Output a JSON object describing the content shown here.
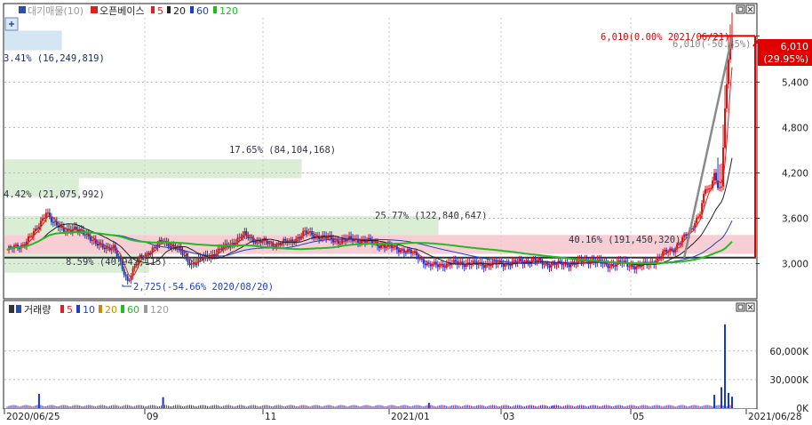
{
  "legend_top": {
    "items": [
      {
        "text": "대기매물(10)",
        "color": "#9a9a9a"
      },
      {
        "text": "오픈베이스",
        "color": "#222222"
      },
      {
        "text": "5",
        "color": "#dd2020"
      },
      {
        "text": "20",
        "color": "#222222"
      },
      {
        "text": "60",
        "color": "#1a3fd0"
      },
      {
        "text": "120",
        "color": "#22bb22"
      }
    ]
  },
  "legend_bottom": {
    "items": [
      {
        "text": "거래량",
        "color": "#222222"
      },
      {
        "text": "5",
        "color": "#dd2020"
      },
      {
        "text": "10",
        "color": "#1a3fd0"
      },
      {
        "text": "20",
        "color": "#d08a00"
      },
      {
        "text": "60",
        "color": "#22bb22"
      },
      {
        "text": "120",
        "color": "#9a9a9a"
      }
    ]
  },
  "chart_data": [
    {
      "type": "candlestick",
      "ylim": [
        2560,
        6250
      ],
      "price_ticks": [
        "6,010",
        "5,400",
        "4,800",
        "4,200",
        "3,600",
        "3,000"
      ],
      "price_tick_values": [
        6010,
        5400,
        4800,
        4200,
        3600,
        3000
      ],
      "x_labels": [
        "2020/06/25",
        "09",
        "11",
        "2021/01",
        "03",
        "05",
        "2021/06/28"
      ],
      "last_price_box": {
        "line1": "6,010",
        "line2": "(29.95%)",
        "value": 6010
      },
      "annotations": {
        "max": {
          "text": "6,010(0.00% 2021/06/21)",
          "value": 6010
        },
        "max_ghost": {
          "text": "6,010(-50.55%)"
        },
        "min": {
          "text": "2,725(-54.66% 2020/08/20)",
          "value": 2725
        }
      },
      "supply_zones": [
        {
          "text": "3.41% (16,249,819)",
          "price_low": 5820,
          "price_high": 6080,
          "width_pct": 3.41
        },
        {
          "text": "17.65% (84,104,168)",
          "price_low": 4130,
          "price_high": 4380,
          "width_pct": 17.65
        },
        {
          "text": "4.42% (21,075,992)",
          "price_low": 3880,
          "price_high": 4130,
          "width_pct": 4.42
        },
        {
          "text": "25.77% (122,840,647)",
          "price_low": 3380,
          "price_high": 3630,
          "width_pct": 25.77
        },
        {
          "text": "40.16% (191,450,320)",
          "price_low": 3130,
          "price_high": 3380,
          "width_pct": 40.16
        },
        {
          "text": "8.59% (40,942,115)",
          "price_low": 2880,
          "price_high": 3130,
          "width_pct": 8.59
        }
      ],
      "base_line": 3080,
      "series": [
        {
          "name": "5",
          "color": "#dd2020"
        },
        {
          "name": "20",
          "color": "#222222"
        },
        {
          "name": "60",
          "color": "#1a3fd0"
        },
        {
          "name": "120",
          "color": "#22bb22"
        }
      ],
      "close_path": [
        [
          0,
          3180
        ],
        [
          8,
          3240
        ],
        [
          16,
          3420
        ],
        [
          22,
          3700
        ],
        [
          26,
          3520
        ],
        [
          34,
          3450
        ],
        [
          44,
          3420
        ],
        [
          50,
          3250
        ],
        [
          60,
          3210
        ],
        [
          68,
          2780
        ],
        [
          74,
          3050
        ],
        [
          80,
          3160
        ],
        [
          88,
          3300
        ],
        [
          95,
          3220
        ],
        [
          104,
          3000
        ],
        [
          112,
          3080
        ],
        [
          118,
          3150
        ],
        [
          126,
          3260
        ],
        [
          134,
          3380
        ],
        [
          140,
          3310
        ],
        [
          150,
          3260
        ],
        [
          160,
          3290
        ],
        [
          168,
          3410
        ],
        [
          176,
          3360
        ],
        [
          186,
          3300
        ],
        [
          196,
          3320
        ],
        [
          204,
          3290
        ],
        [
          214,
          3230
        ],
        [
          224,
          3180
        ],
        [
          232,
          3100
        ],
        [
          238,
          2970
        ],
        [
          246,
          2990
        ],
        [
          256,
          3010
        ],
        [
          266,
          2990
        ],
        [
          276,
          3000
        ],
        [
          286,
          3010
        ],
        [
          296,
          3050
        ],
        [
          304,
          3000
        ],
        [
          312,
          2990
        ],
        [
          322,
          3020
        ],
        [
          330,
          3050
        ],
        [
          338,
          2980
        ],
        [
          346,
          3010
        ],
        [
          356,
          2960
        ],
        [
          364,
          3020
        ],
        [
          372,
          3160
        ],
        [
          376,
          3200
        ],
        [
          381,
          3320
        ],
        [
          385,
          3420
        ],
        [
          388,
          3560
        ],
        [
          391,
          3680
        ],
        [
          394,
          3980
        ],
        [
          397,
          4000
        ],
        [
          399,
          4200
        ],
        [
          401,
          4000
        ],
        [
          403,
          4020
        ],
        [
          405,
          5050
        ],
        [
          407,
          5700
        ],
        [
          409,
          6010
        ]
      ]
    },
    {
      "type": "bar",
      "name": "거래량",
      "ylim": [
        0,
        100000
      ],
      "ticks": [
        "60,000K",
        "30,000K",
        "0K"
      ],
      "tick_values": [
        60000,
        30000,
        0
      ],
      "spikes": [
        {
          "x": 18,
          "value": 15000
        },
        {
          "x": 88,
          "value": 11500
        },
        {
          "x": 238,
          "value": 5500
        },
        {
          "x": 308,
          "value": 2500
        },
        {
          "x": 399,
          "value": 14000
        },
        {
          "x": 403,
          "value": 22000
        },
        {
          "x": 405,
          "value": 88000
        },
        {
          "x": 407,
          "value": 16000
        },
        {
          "x": 409,
          "value": 12000
        }
      ],
      "baseline_level": 1500
    }
  ]
}
